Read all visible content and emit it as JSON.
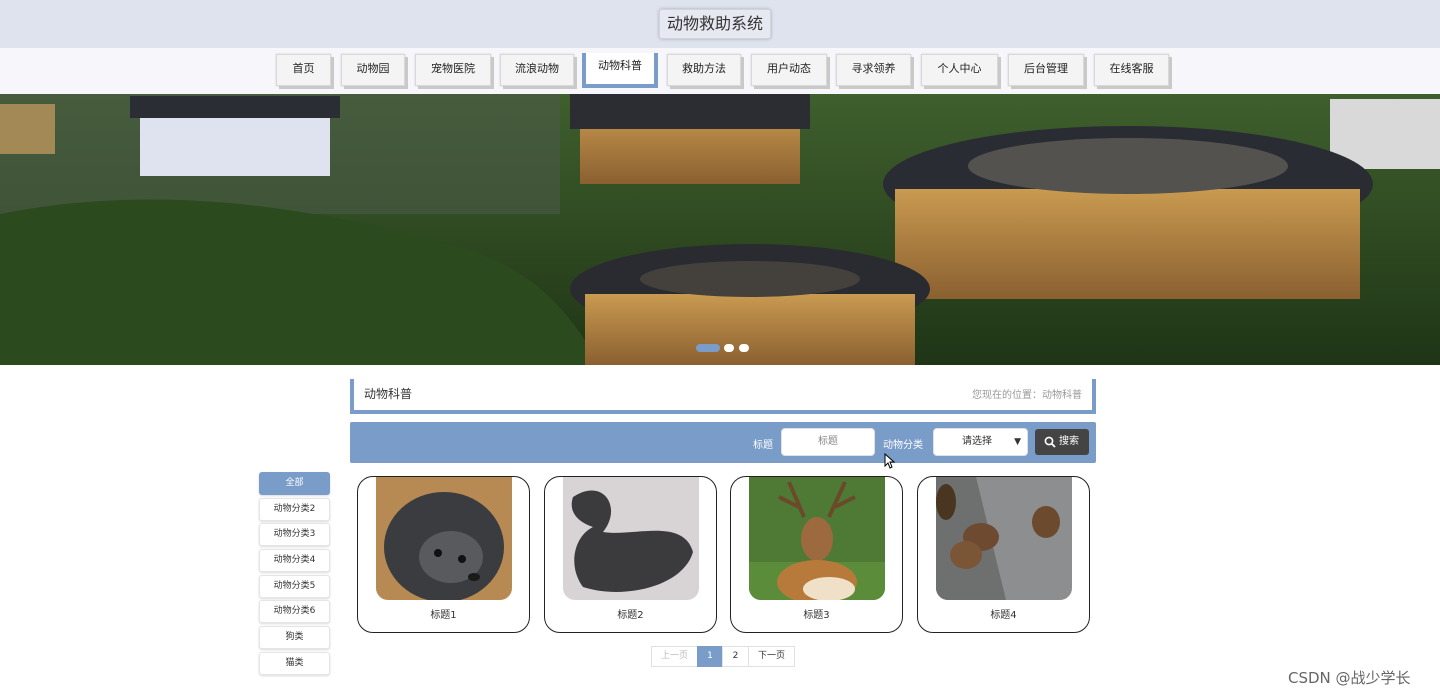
{
  "header": {
    "site_title": "动物救助系统"
  },
  "nav": {
    "items": [
      {
        "label": "首页",
        "active": false
      },
      {
        "label": "动物园",
        "active": false
      },
      {
        "label": "宠物医院",
        "active": false
      },
      {
        "label": "流浪动物",
        "active": false
      },
      {
        "label": "动物科普",
        "active": true
      },
      {
        "label": "救助方法",
        "active": false
      },
      {
        "label": "用户动态",
        "active": false
      },
      {
        "label": "寻求领养",
        "active": false
      },
      {
        "label": "个人中心",
        "active": false
      },
      {
        "label": "后台管理",
        "active": false
      },
      {
        "label": "在线客服",
        "active": false
      }
    ]
  },
  "banner": {
    "active_dot": 1,
    "dot_count": 3
  },
  "breadcrumb": {
    "title": "动物科普",
    "location": "您现在的位置：动物科普"
  },
  "search": {
    "title_label": "标题",
    "title_placeholder": "标题",
    "category_label": "动物分类",
    "category_selected": "请选择",
    "button_label": "搜索"
  },
  "sidebar": {
    "items": [
      {
        "label": "全部",
        "active": true
      },
      {
        "label": "动物分类2",
        "active": false
      },
      {
        "label": "动物分类3",
        "active": false
      },
      {
        "label": "动物分类4",
        "active": false
      },
      {
        "label": "动物分类5",
        "active": false
      },
      {
        "label": "动物分类6",
        "active": false
      },
      {
        "label": "狗类",
        "active": false
      },
      {
        "label": "猫类",
        "active": false
      }
    ]
  },
  "cards": [
    {
      "label": "标题1",
      "image": "binturong"
    },
    {
      "label": "标题2",
      "image": "whale"
    },
    {
      "label": "标题3",
      "image": "deer"
    },
    {
      "label": "标题4",
      "image": "bears"
    }
  ],
  "pagination": {
    "prev": "上一页",
    "pages": [
      "1",
      "2"
    ],
    "current": "1",
    "next": "下一页"
  },
  "watermark": "CSDN @战少学长",
  "colors": {
    "accent": "#7a9cc8",
    "topbar": "#dfe3ee",
    "search_button": "#444444"
  }
}
